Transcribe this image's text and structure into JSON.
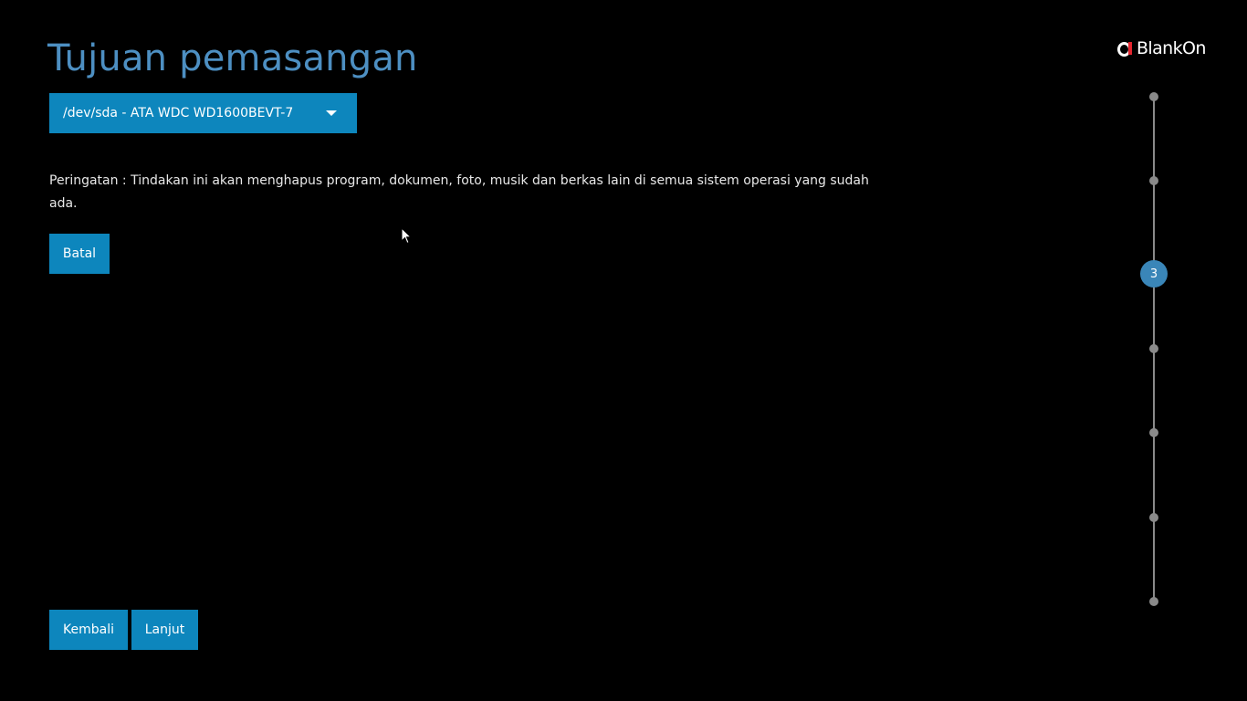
{
  "header": {
    "title": "Tujuan pemasangan"
  },
  "brand": {
    "logo_text": "BlankOn",
    "logo_icon": "blankon-logo-icon",
    "logo_accent_color": "#e5262f"
  },
  "disk_select": {
    "selected_value": "/dev/sda - ATA WDC WD1600BEVT-7",
    "icon": "chevron-down-icon"
  },
  "warning": {
    "text": "Peringatan : Tindakan ini akan menghapus program, dokumen, foto, musik dan berkas lain di semua sistem operasi yang sudah ada."
  },
  "actions": {
    "cancel_label": "Batal",
    "back_label": "Kembali",
    "next_label": "Lanjut"
  },
  "stepper": {
    "total_steps": 7,
    "current_step": 3,
    "current_label": "3"
  },
  "colors": {
    "background": "#000000",
    "accent": "#0d86bd",
    "title": "#4d8fc2",
    "step_active": "#3a86b8",
    "step_inactive": "#8a8a8a"
  }
}
